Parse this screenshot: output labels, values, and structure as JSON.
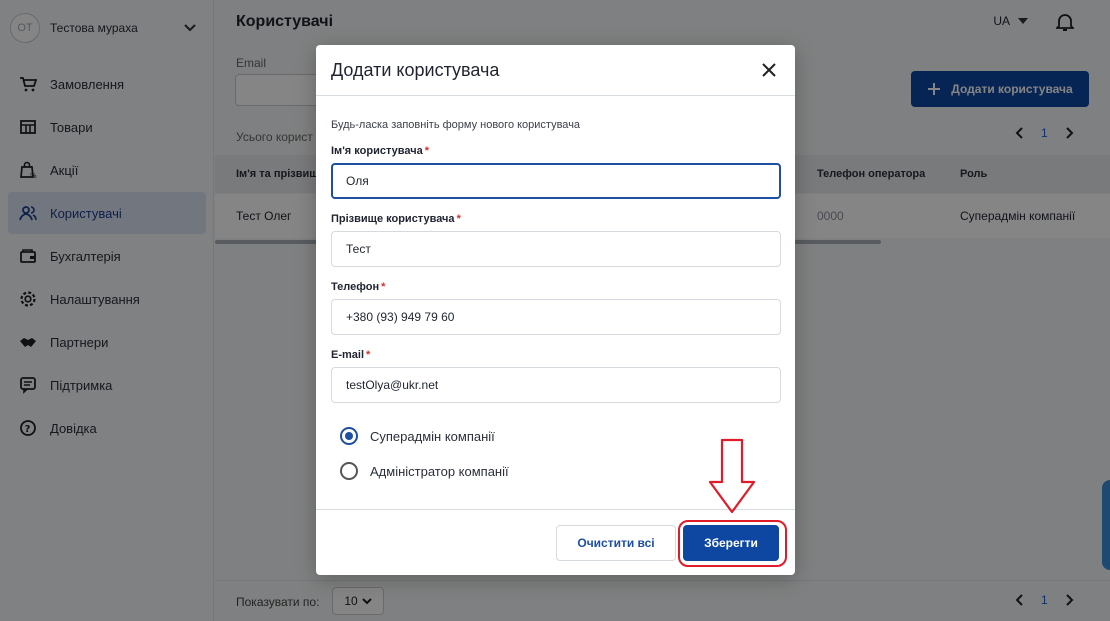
{
  "company": {
    "avatar": "ОТ",
    "name": "Тестова мураха"
  },
  "nav": [
    {
      "label": "Замовлення",
      "icon": "cart-icon"
    },
    {
      "label": "Товари",
      "icon": "store-icon"
    },
    {
      "label": "Акції",
      "icon": "promo-bag-icon"
    },
    {
      "label": "Користувачі",
      "icon": "users-icon",
      "active": true
    },
    {
      "label": "Бухгалтерія",
      "icon": "wallet-icon"
    },
    {
      "label": "Налаштування",
      "icon": "gear-icon"
    },
    {
      "label": "Партнери",
      "icon": "handshake-icon"
    },
    {
      "label": "Підтримка",
      "icon": "chat-icon"
    },
    {
      "label": "Довідка",
      "icon": "help-icon"
    }
  ],
  "header": {
    "title": "Користувачі",
    "lang": "UA"
  },
  "filters": {
    "email_label": "Email"
  },
  "add_user_label": "Додати користувача",
  "total_label": "Усього корист",
  "pager": {
    "page": "1"
  },
  "table": {
    "headers": {
      "name": "Ім'я та прізвищ",
      "operator_phone": "Телефон оператора",
      "role": "Роль"
    },
    "row": {
      "name": "Тест Олег",
      "operator_phone": "0000",
      "role": "Суперадмін компанії"
    }
  },
  "footer": {
    "show_label": "Показувати по:",
    "per_page": "10"
  },
  "modal": {
    "title": "Додати користувача",
    "hint": "Будь-ласка заповніть форму нового користувача",
    "first_name_label": "Ім'я користувача",
    "first_name_value": "Оля",
    "last_name_label": "Прізвище користувача",
    "last_name_value": "Тест",
    "phone_label": "Телефон",
    "phone_value": "+380 (93) 949 79 60",
    "email_label": "E-mail",
    "email_value": "testOlya@ukr.net",
    "roles": [
      {
        "label": "Суперадмін компанії",
        "selected": true
      },
      {
        "label": "Адміністратор компанії",
        "selected": false
      }
    ],
    "clear_label": "Очистити всі",
    "save_label": "Зберегти"
  },
  "colors": {
    "accent": "#0d47a1",
    "highlight": "#e01c2b",
    "active_nav_bg": "#d9e3f3"
  }
}
